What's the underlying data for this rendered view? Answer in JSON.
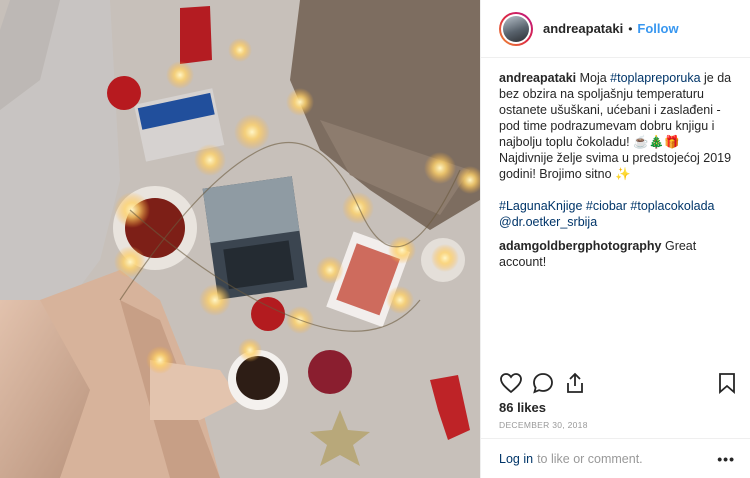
{
  "post": {
    "username": "andreapataki",
    "dot": "•",
    "follow_label": "Follow",
    "caption": {
      "user": "andreapataki",
      "t1": " Moja ",
      "tag1": "#toplapreporuka",
      "t2": " je da bez obzira na spoljašnju temperaturu ostanete ušuškani, ućebani i zaslađeni - pod time podrazumevam dobru knjigu i najbolju toplu čokoladu! ",
      "emoji1": "☕🎄🎁",
      "t3": "Najdivnije želje svima u predstojećoj 2019 godini! Brojimo sitno ",
      "emoji2": "✨",
      "tag2": "#LagunaKnjige",
      "tag3": "#ciobar",
      "tag4": "#toplacokolada",
      "mention": "@dr.oetker_srbija"
    },
    "comment": {
      "user": "adamgoldbergphotography",
      "text": " Great account!"
    },
    "likes": "86 likes",
    "date": "DECEMBER 30, 2018",
    "login_label": "Log in",
    "comment_prompt": "to like or comment.",
    "more_label": "•••"
  }
}
